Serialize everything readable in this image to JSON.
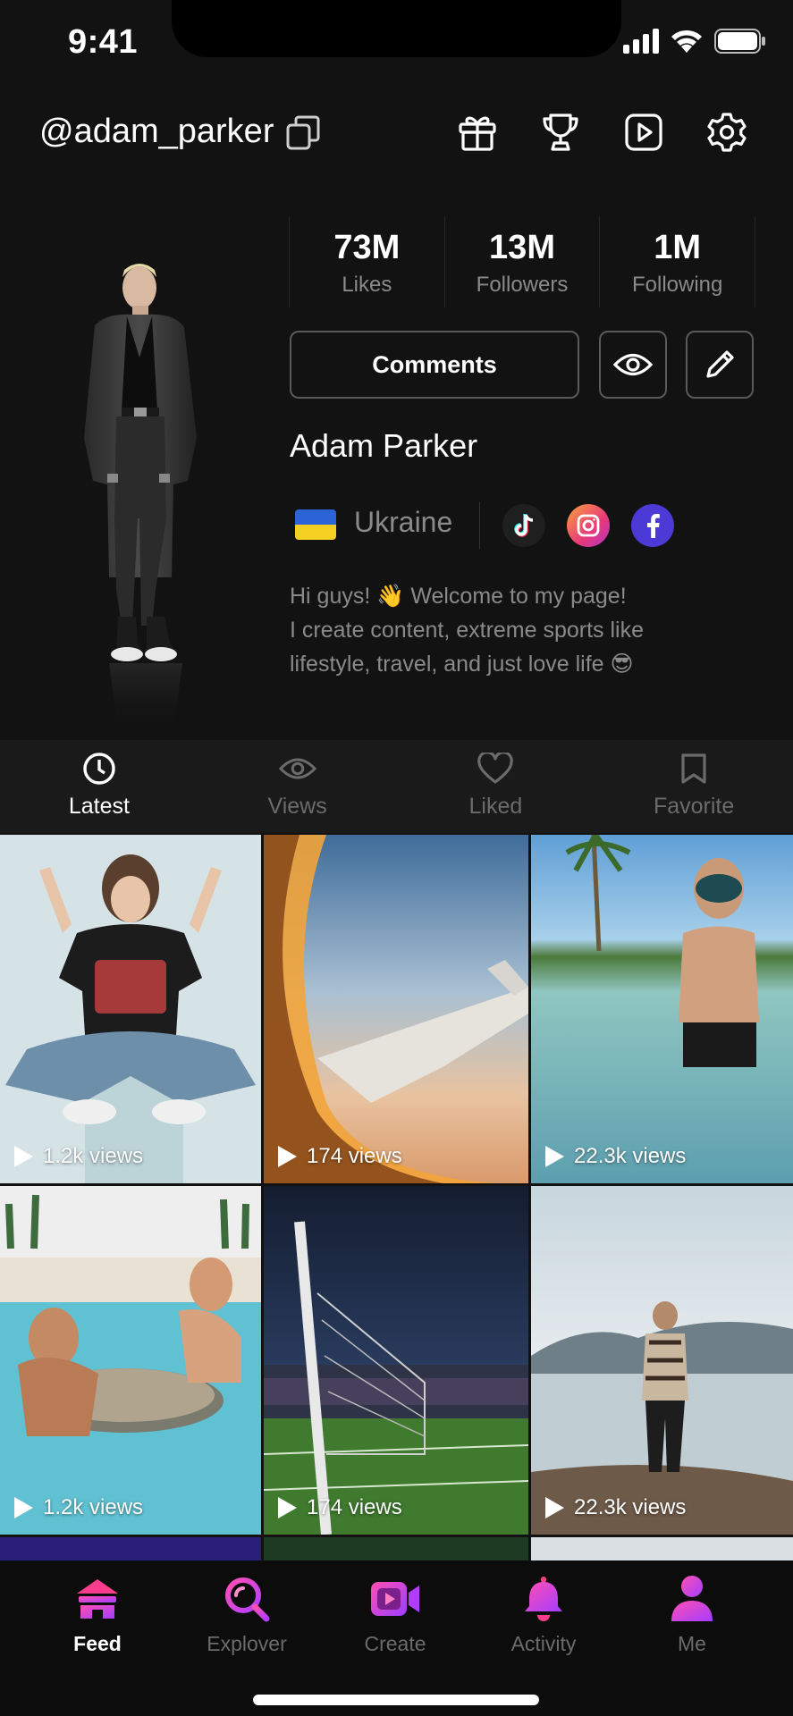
{
  "status_bar": {
    "time": "9:41"
  },
  "header": {
    "username": "@adam_parker",
    "icons": [
      "copy-icon",
      "gift-icon",
      "trophy-icon",
      "play-square-icon",
      "gear-icon"
    ]
  },
  "profile": {
    "stats": [
      {
        "value": "73M",
        "label": "Likes"
      },
      {
        "value": "13M",
        "label": "Followers"
      },
      {
        "value": "1M",
        "label": "Following"
      }
    ],
    "comments_label": "Comments",
    "name": "Adam Parker",
    "country": "Ukraine",
    "socials": [
      "tiktok-icon",
      "instagram-icon",
      "facebook-icon"
    ],
    "bio_lines": [
      "Hi guys! 👋 Welcome to my page!",
      "I create content, extreme sports like",
      "lifestyle, travel, and just love life 😎"
    ]
  },
  "tabs": [
    {
      "label": "Latest",
      "icon": "clock-icon",
      "active": true
    },
    {
      "label": "Views",
      "icon": "eye-icon",
      "active": false
    },
    {
      "label": "Liked",
      "icon": "heart-icon",
      "active": false
    },
    {
      "label": "Favorite",
      "icon": "bookmark-icon",
      "active": false
    }
  ],
  "feed": [
    {
      "views": "1.2k views",
      "scene": "woman-sitting-gesture"
    },
    {
      "views": "174 views",
      "scene": "airplane-wing-sunset"
    },
    {
      "views": "22.3k views",
      "scene": "snorkel-boy-sea"
    },
    {
      "views": "1.2k views",
      "scene": "friends-pool-drinks"
    },
    {
      "views": "174 views",
      "scene": "football-goal-stadium"
    },
    {
      "views": "22.3k views",
      "scene": "man-lake-view"
    }
  ],
  "bottom_nav": [
    {
      "label": "Feed",
      "icon": "home-icon",
      "active": true
    },
    {
      "label": "Explover",
      "icon": "search-icon",
      "active": false
    },
    {
      "label": "Create",
      "icon": "video-camera-icon",
      "active": false
    },
    {
      "label": "Activity",
      "icon": "bell-icon",
      "active": false
    },
    {
      "label": "Me",
      "icon": "person-icon",
      "active": false
    }
  ],
  "colors": {
    "background": "#121212",
    "accent_pink": "#ff3fa4",
    "accent_purple": "#8b3dff",
    "muted_text": "#8a8a8a"
  }
}
